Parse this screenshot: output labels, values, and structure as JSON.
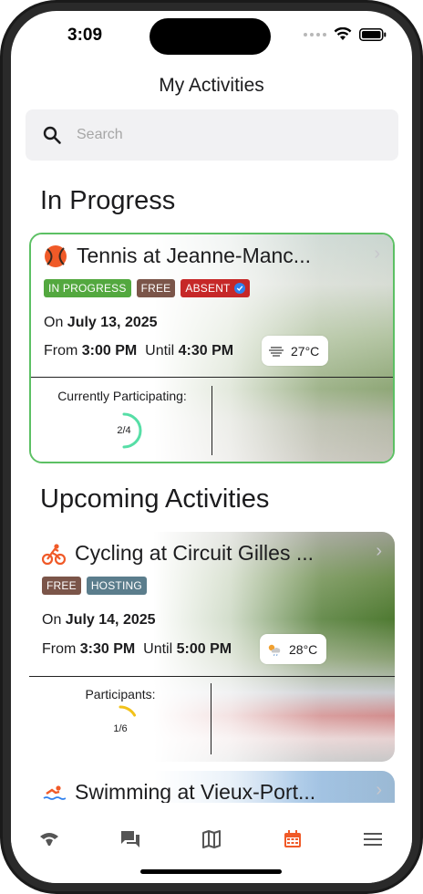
{
  "status_bar": {
    "time": "3:09"
  },
  "nav": {
    "title": "My Activities"
  },
  "search": {
    "placeholder": "Search"
  },
  "sections": {
    "in_progress": "In Progress",
    "upcoming": "Upcoming Activities"
  },
  "cards": [
    {
      "sport_icon": "tennis-ball-icon",
      "title": "Tennis at Jeanne-Manc...",
      "badges": [
        "IN PROGRESS",
        "FREE",
        "ABSENT"
      ],
      "date_prefix": "On",
      "date": "July 13, 2025",
      "from_label": "From",
      "from_time": "3:00 PM",
      "until_label": "Until",
      "until_time": "4:30 PM",
      "weather_icon": "fog-icon",
      "temperature": "27°C",
      "stat_label": "Currently Participating:",
      "participants_text": "2/4",
      "participants_fraction": 0.5
    },
    {
      "sport_icon": "cycling-icon",
      "title": "Cycling at Circuit Gilles ...",
      "badges": [
        "FREE",
        "HOSTING"
      ],
      "date_prefix": "On",
      "date": "July 14, 2025",
      "from_label": "From",
      "from_time": "3:30 PM",
      "until_label": "Until",
      "until_time": "5:00 PM",
      "weather_icon": "sun-rain-cloud-icon",
      "temperature": "28°C",
      "stat_label": "Participants:",
      "participants_text": "1/6",
      "participants_fraction": 0.1667
    },
    {
      "sport_icon": "swimming-icon",
      "title": "Swimming at Vieux-Port..."
    }
  ],
  "tab_bar": {
    "items": [
      "stadium-icon",
      "chat-icon",
      "map-icon",
      "calendar-icon",
      "menu-icon"
    ],
    "active_index": 3
  },
  "colors": {
    "accent_orange": "#f05a28",
    "active_border": "#5cc064",
    "gauge_green": "#56dea6",
    "gauge_yellow": "#f2c21a"
  }
}
